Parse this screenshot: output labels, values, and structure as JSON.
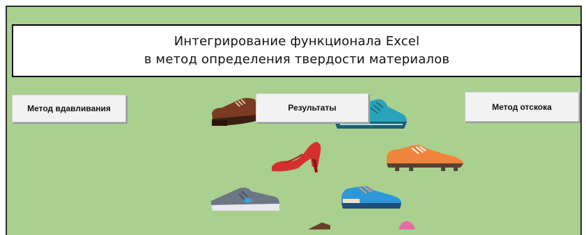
{
  "title": {
    "line1": "Интегрирование функционала Excel",
    "line2": "в метод определения твердости материалов"
  },
  "buttons": {
    "indentation": "Метод вдавливания",
    "results": "Результаты",
    "rebound": "Метод отскока"
  },
  "colors": {
    "background": "#a9d08e",
    "button_face": "#f2f2f2"
  },
  "icons": [
    "brown-oxford-shoe-icon",
    "teal-sneaker-icon",
    "red-high-heel-icon",
    "orange-cleat-icon",
    "gray-sneaker-icon",
    "blue-sneaker-icon"
  ]
}
